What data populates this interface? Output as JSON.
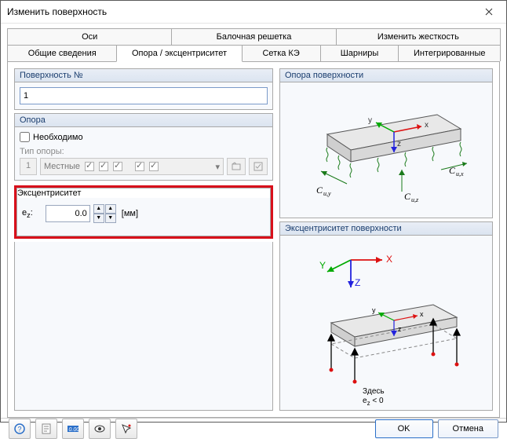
{
  "window": {
    "title": "Изменить поверхность"
  },
  "tabs_top": [
    "Оси",
    "Балочная решетка",
    "Изменить жесткость"
  ],
  "tabs_bottom": [
    "Общие сведения",
    "Опора / эксцентриситет",
    "Сетка КЭ",
    "Шарниры",
    "Интегрированные"
  ],
  "active_tab": 1,
  "left": {
    "surface_no_title": "Поверхность №",
    "surface_no_value": "1",
    "support_title": "Опора",
    "required_label": "Необходимо",
    "required_checked": false,
    "type_label": "Тип опоры:",
    "type_no": "1",
    "type_combo": "Местные",
    "ecc_title": "Эксцентриситет",
    "ez_label": "e",
    "ez_sub": "z",
    "ez_colon": ":",
    "ez_value": "0.0",
    "ez_unit": "[мм]"
  },
  "right": {
    "support_diag_title": "Опора поверхности",
    "ecc_diag_title": "Эксцентриситет поверхности",
    "labels": {
      "x": "x",
      "y": "y",
      "z": "z",
      "X": "X",
      "Y": "Y",
      "Z": "Z",
      "cux": "Cu,x",
      "cuy": "Cu,y",
      "cuz": "Cu,z",
      "here": "Здесь",
      "ezlt": "e",
      "ezlt_sub": "z",
      "ezlt_tail": " < 0"
    }
  },
  "footer": {
    "ok": "OK",
    "cancel": "Отмена"
  }
}
